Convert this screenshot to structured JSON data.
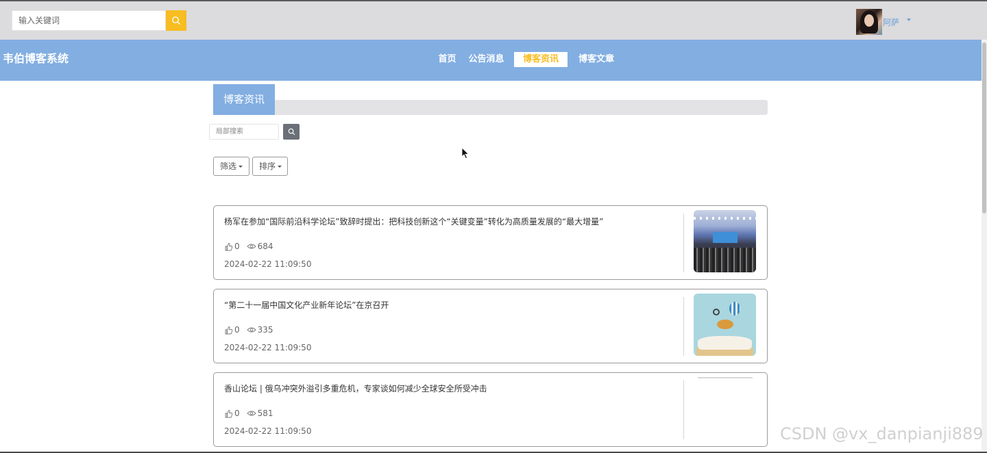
{
  "header": {
    "search_placeholder": "输入关键词",
    "search_icon": "search-icon",
    "user": {
      "name": "阿萨",
      "avatar": "avatar-photo"
    }
  },
  "navbar": {
    "brand": "韦伯博客系统",
    "items": [
      {
        "label": "首页",
        "active": false
      },
      {
        "label": "公告消息",
        "active": false
      },
      {
        "label": "博客资讯",
        "active": true
      },
      {
        "label": "博客文章",
        "active": false
      }
    ],
    "accent_color": "#82aee2",
    "active_color": "#f7bd21"
  },
  "section": {
    "title": "博客资讯"
  },
  "filters": {
    "local_search_placeholder": "局部搜索",
    "filter_label": "筛选",
    "sort_label": "排序"
  },
  "articles": [
    {
      "title": "杨军在参加“国际前沿科学论坛”致辞时提出：把科技创新这个“关键变量”转化为高质量发展的“最大增量”",
      "likes": "0",
      "views": "684",
      "date": "2024-02-22 11:09:50",
      "image": "conference-hall-image"
    },
    {
      "title": "“第二十一届中国文化产业新年论坛”在京召开",
      "likes": "0",
      "views": "335",
      "date": "2024-02-22 11:09:50",
      "image": "open-book-illustration"
    },
    {
      "title": "香山论坛 | 俄乌冲突外溢引多重危机，专家谈如何减少全球安全所受冲击",
      "likes": "0",
      "views": "581",
      "date": "2024-02-22 11:09:50",
      "image": "blank-image"
    }
  ],
  "watermark": "CSDN @vx_danpianji889"
}
